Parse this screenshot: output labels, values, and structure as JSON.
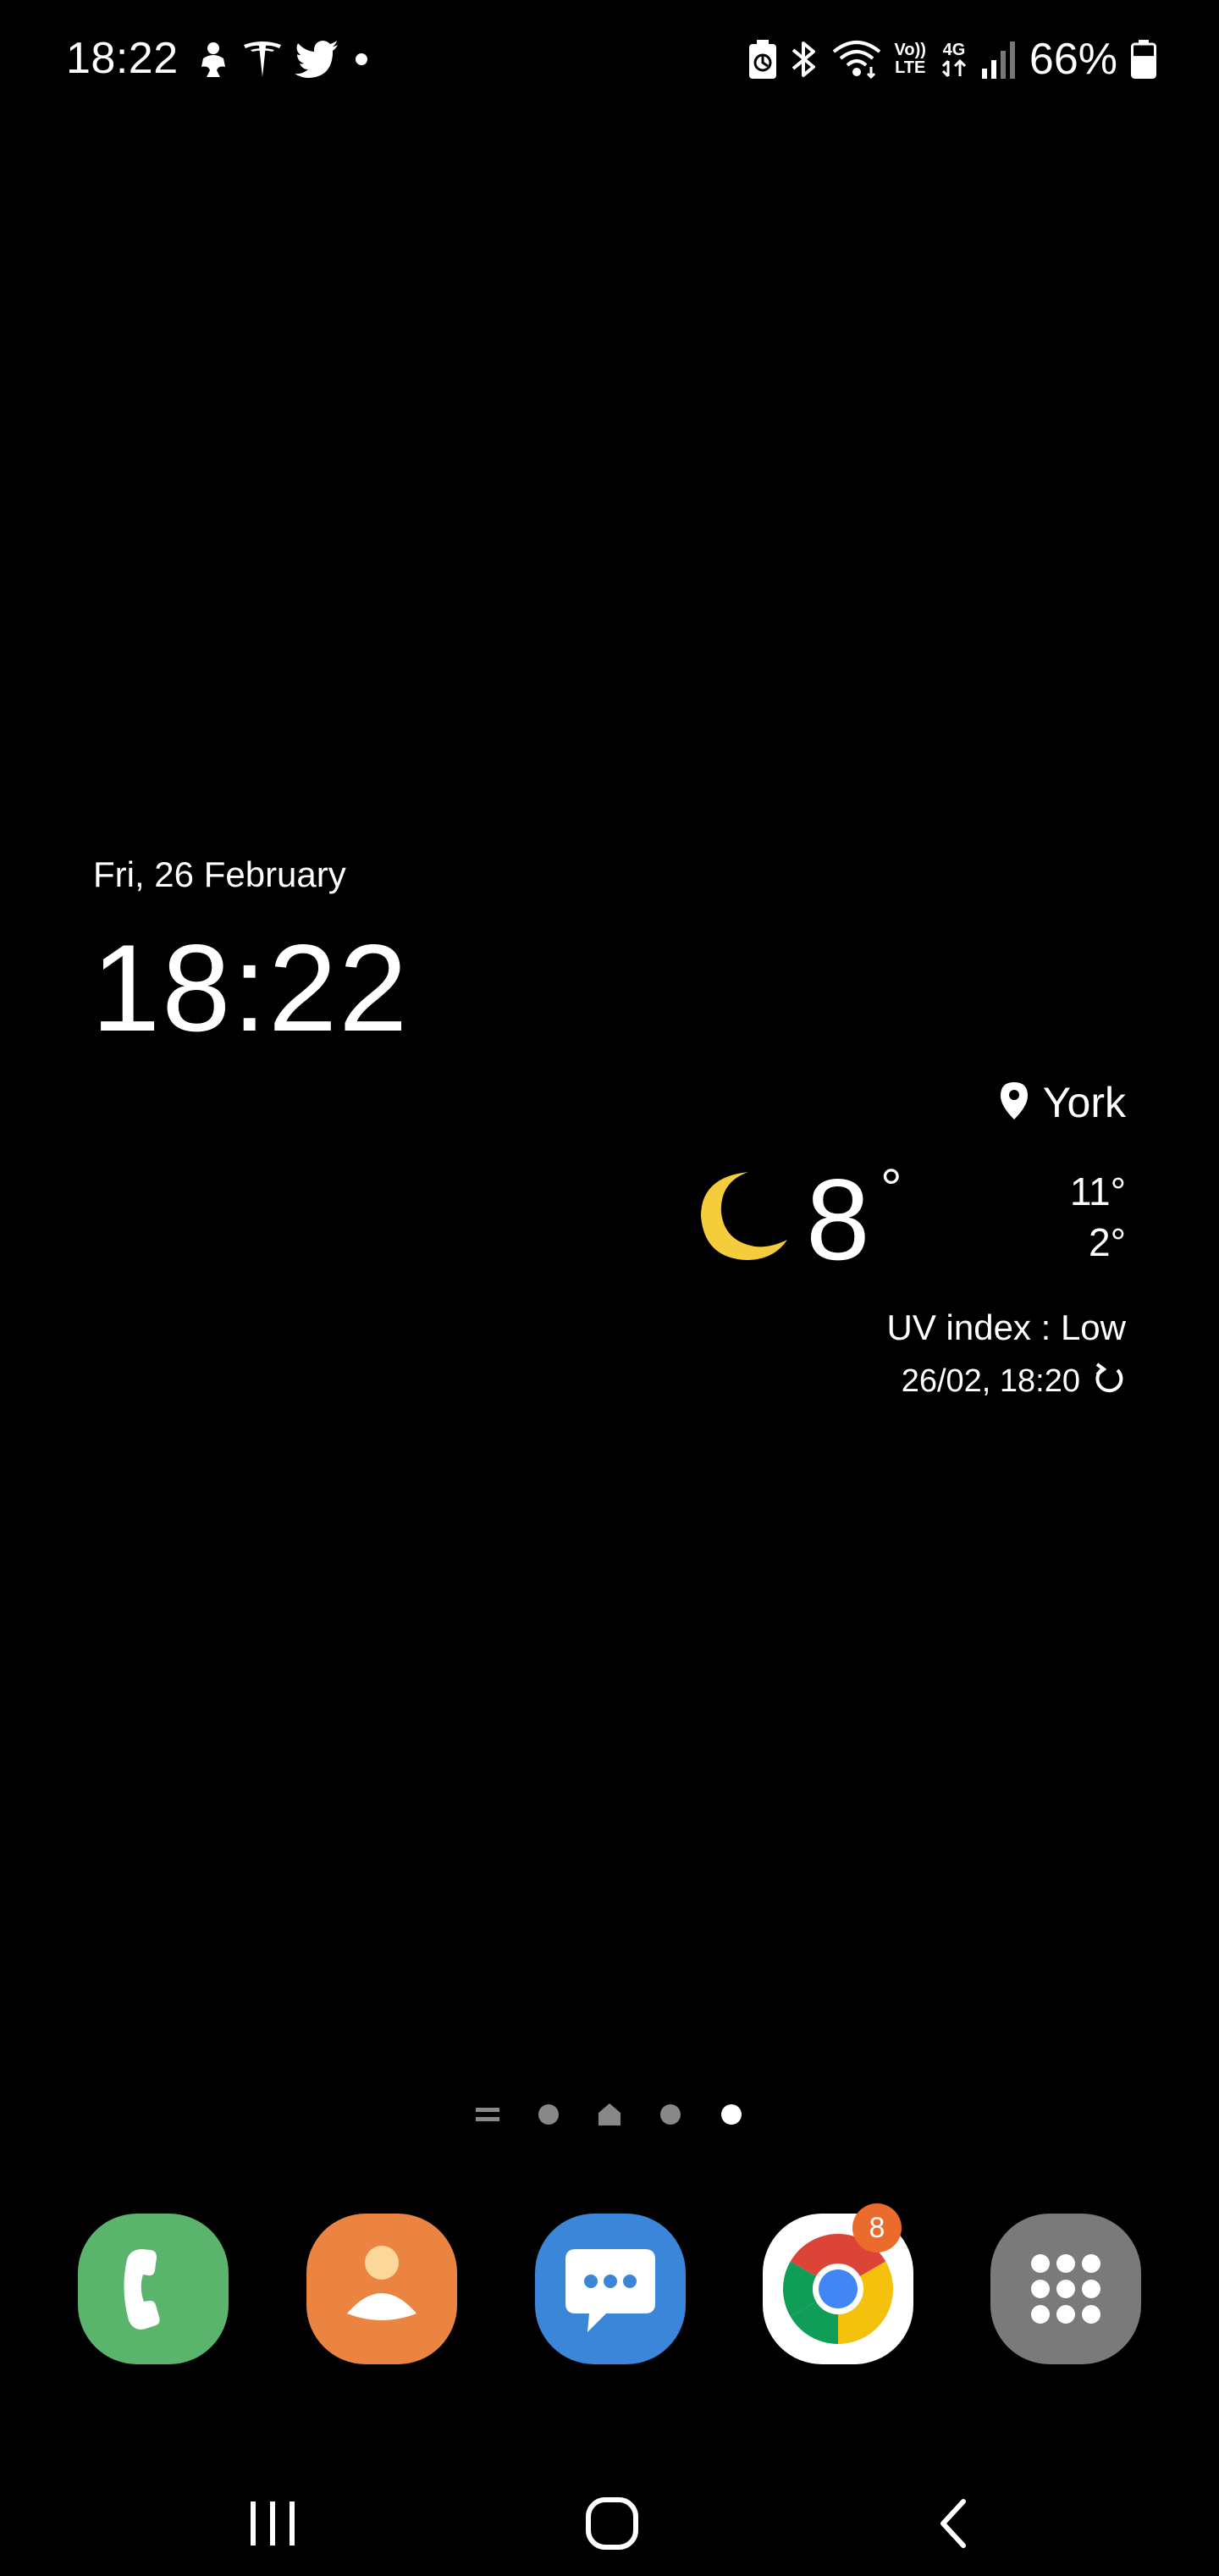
{
  "status_bar": {
    "time": "18:22",
    "notification_icons": [
      "child-mode-icon",
      "tesla-icon",
      "twitter-icon",
      "more-dot-icon"
    ],
    "system_icons": [
      "battery-saver-icon",
      "bluetooth-icon",
      "wifi-icon",
      "volte-icon",
      "4g-data-icon",
      "signal-icon"
    ],
    "volte_label_top": "Vo))",
    "volte_label_bottom": "LTE",
    "network_label": "4G",
    "battery_percent": "66%",
    "battery_level": 0.66
  },
  "clock_widget": {
    "date": "Fri, 26 February",
    "time": "18:22"
  },
  "weather_widget": {
    "location": "York",
    "condition_icon": "moon-icon",
    "temperature": "8",
    "degree": "°",
    "high": "11°",
    "low": "2°",
    "uv_index": "UV index : Low",
    "updated": "26/02, 18:20"
  },
  "page_indicator": {
    "pages": [
      "list-page",
      "page",
      "home-page",
      "page",
      "page"
    ],
    "active_index": 4
  },
  "dock": {
    "apps": [
      {
        "name": "Phone",
        "icon": "phone-icon",
        "color": "#5ab46c"
      },
      {
        "name": "Contacts",
        "icon": "contact-icon",
        "color": "#ea8440"
      },
      {
        "name": "Messages",
        "icon": "message-icon",
        "color": "#3b86d8"
      },
      {
        "name": "Chrome",
        "icon": "chrome-icon",
        "color": "#ffffff",
        "badge": "8"
      },
      {
        "name": "Apps",
        "icon": "apps-grid-icon",
        "color": "#7a7a7a"
      }
    ]
  },
  "nav_bar": {
    "buttons": [
      "recent-apps",
      "home",
      "back"
    ]
  },
  "colors": {
    "background": "#000000",
    "text": "#ffffff",
    "moon": "#f5cd3c",
    "badge": "#ea6b2b"
  }
}
